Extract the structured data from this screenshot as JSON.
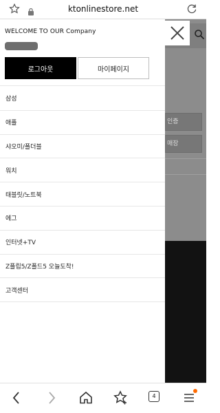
{
  "browser": {
    "url": "ktonlinestore.net"
  },
  "background_page": {
    "box1_text": "인증",
    "box2_text": "매장"
  },
  "drawer": {
    "welcome": "WELCOME TO OUR Company",
    "logout_label": "로그아웃",
    "mypage_label": "마이페이지",
    "menu": [
      {
        "label": "삼성"
      },
      {
        "label": "애플"
      },
      {
        "label": "샤오미/폴더블"
      },
      {
        "label": "워치"
      },
      {
        "label": "태블릿/노트북"
      },
      {
        "label": "에그"
      },
      {
        "label": "인터넷+TV"
      },
      {
        "label": "Z플립5/Z폴드5 오늘도착!"
      },
      {
        "label": "고객센터"
      }
    ]
  },
  "bottom_nav": {
    "tab_count": "4"
  },
  "colors": {
    "accent_dot": "#ff6a00",
    "overlay": "#8c8c8c"
  }
}
